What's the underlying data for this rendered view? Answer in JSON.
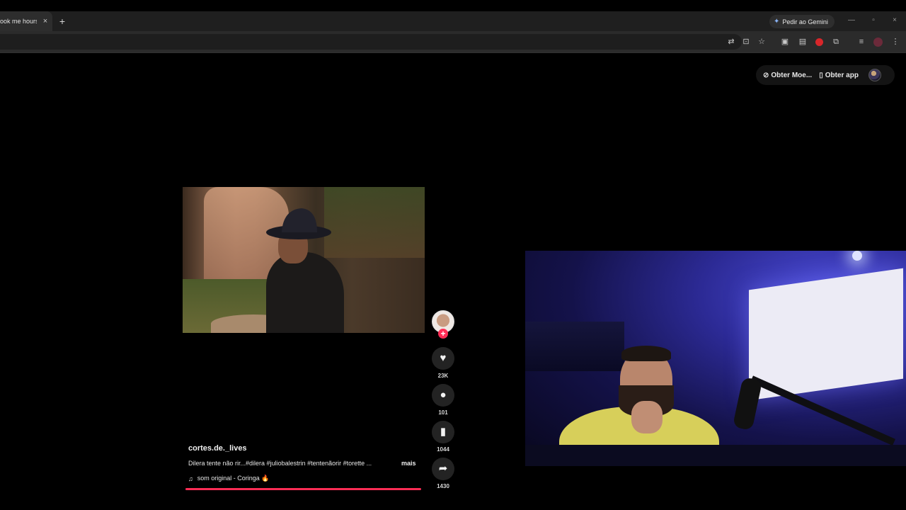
{
  "browser": {
    "tab_title": "ook me hours",
    "tab_close_glyph": "×",
    "new_tab_glyph": "+",
    "gemini_button": "Pedir ao Gemini",
    "window": {
      "minimize": "—",
      "restore": "▫",
      "close": "×"
    }
  },
  "toolbar_icons": [
    "translate-icon",
    "install-icon",
    "star-icon",
    "extension-1",
    "extension-2",
    "extension-red",
    "puzzle-icon",
    "media-icon",
    "profile-icon",
    "menu-icon"
  ],
  "tiktok_header": {
    "get_coins": "Obter Moe...",
    "get_app": "Obter app"
  },
  "video": {
    "creator_username": "cortes.de._lives",
    "description": "Dilera tente não rir...#dilera #juliobalestrin #tentenãorir #torette ...",
    "more_label": "mais",
    "music": "som original - Coringa 🔥",
    "progress_fraction": 0.99,
    "actions": {
      "likes": "23K",
      "comments": "101",
      "saves": "1044",
      "shares": "1430"
    }
  },
  "colors": {
    "accent": "#fe2c55",
    "background": "#000000",
    "chrome_tabbar": "#1f1f1f",
    "chrome_toolbar": "#2b2b2b"
  }
}
